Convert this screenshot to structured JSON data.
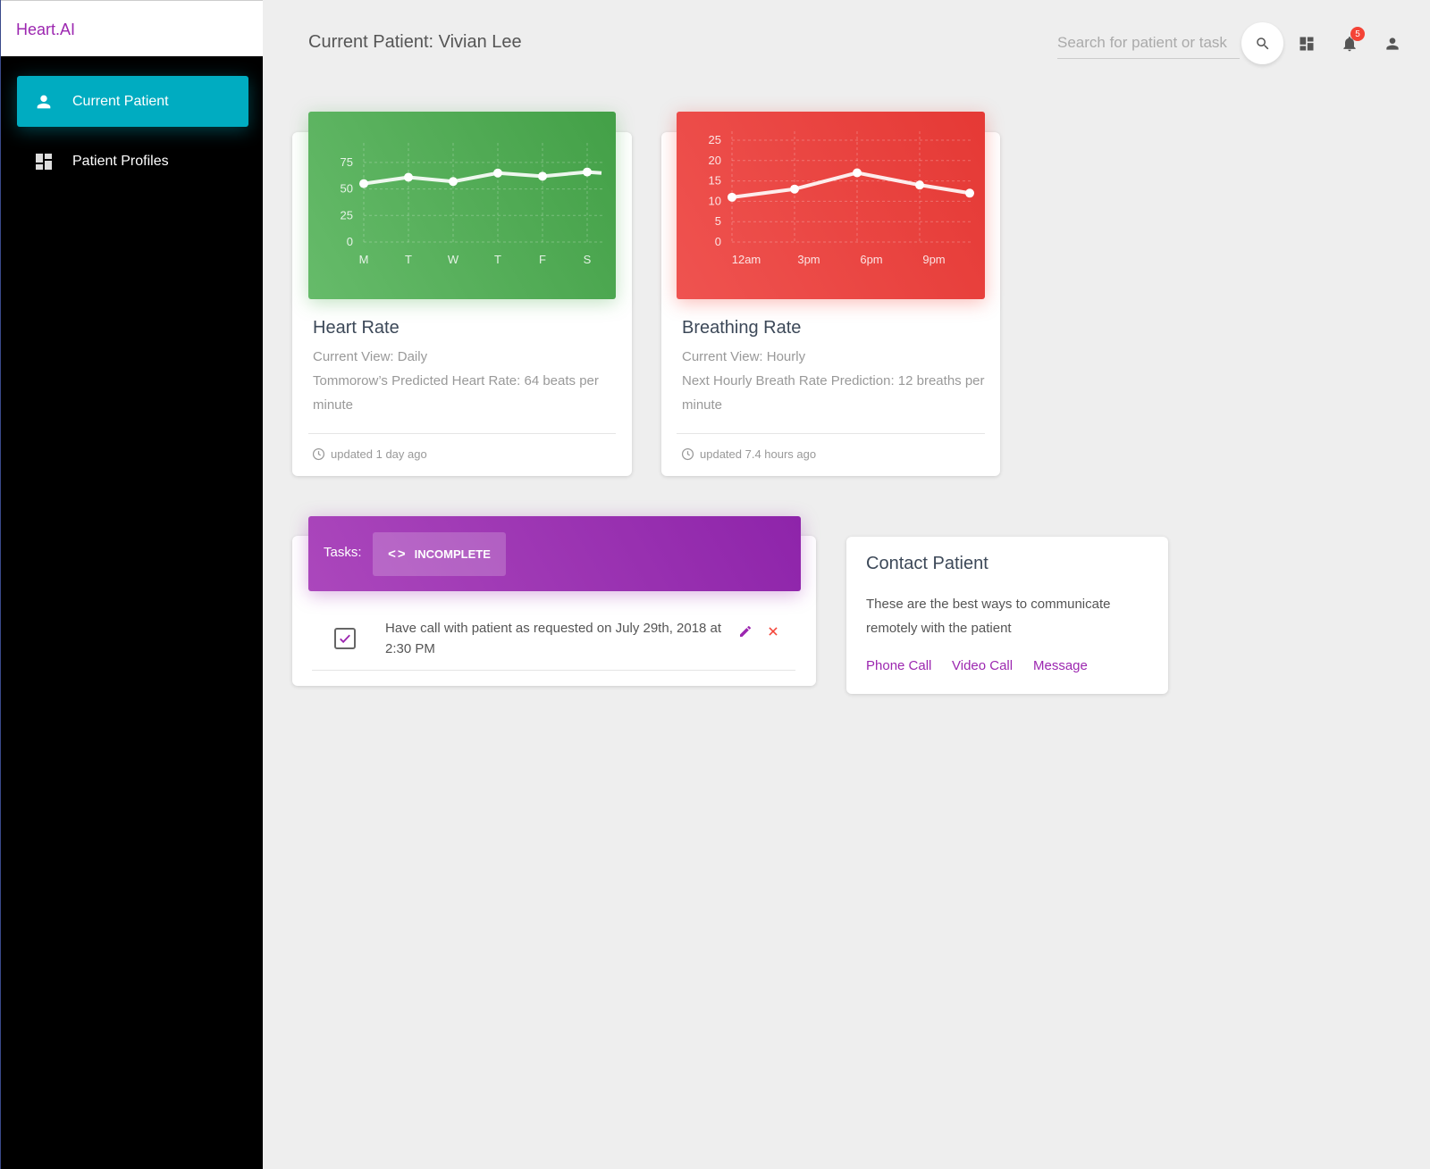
{
  "app": {
    "brand": "Heart.AI"
  },
  "sidebar": {
    "items": [
      {
        "label": "Current Patient",
        "icon": "person-icon",
        "active": true
      },
      {
        "label": "Patient Profiles",
        "icon": "dashboard-icon",
        "active": false
      }
    ]
  },
  "header": {
    "title": "Current Patient: Vivian Lee",
    "search_placeholder": "Search for patient or task",
    "notification_count": "5"
  },
  "heart_card": {
    "title": "Heart Rate",
    "view": "Current View: Daily",
    "prediction": "Tommorow’s Predicted Heart Rate: 64 beats per minute",
    "updated": "updated 1 day ago"
  },
  "breath_card": {
    "title": "Breathing Rate",
    "view": "Current View: Hourly",
    "prediction": "Next Hourly Breath Rate Prediction: 12 breaths per minute",
    "updated": "updated 7.4 hours ago"
  },
  "tasks": {
    "label": "Tasks:",
    "tab": "INCOMPLETE",
    "items": [
      {
        "text": "Have call with patient as requested on July 29th, 2018 at 2:30 PM",
        "checked": true
      }
    ]
  },
  "contact": {
    "title": "Contact Patient",
    "description": "These are the best ways to communicate remotely with the patient",
    "links": [
      "Phone Call",
      "Video Call",
      "Message"
    ]
  },
  "colors": {
    "brand": "#9c27b0",
    "active_nav": "#00acc1",
    "heart_chart": "#4caf50",
    "breath_chart": "#f44336",
    "tasks_header": "#9c27b0",
    "delete": "#f44336"
  },
  "chart_data": [
    {
      "type": "line",
      "categories": [
        "M",
        "T",
        "W",
        "T",
        "F",
        "S"
      ],
      "values": [
        55,
        61,
        57,
        65,
        62,
        66
      ],
      "yticks": [
        0,
        25,
        50,
        75
      ],
      "ylim": [
        0,
        85
      ],
      "grid": true
    },
    {
      "type": "line",
      "categories": [
        "12am",
        "3pm",
        "6pm",
        "9pm"
      ],
      "values": [
        11,
        13,
        17,
        14,
        12
      ],
      "yticks": [
        0,
        5,
        10,
        15,
        20,
        25
      ],
      "ylim": [
        0,
        25
      ],
      "grid": true
    }
  ]
}
